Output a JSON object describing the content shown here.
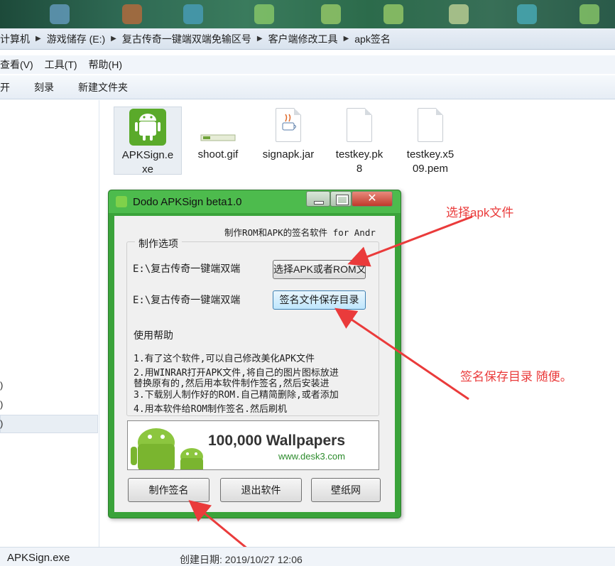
{
  "address_bar": {
    "crumbs": [
      "计算机",
      "游戏储存 (E:)",
      "复古传奇一键端双端免输区号",
      "客户端修改工具",
      "apk签名"
    ]
  },
  "menu_bar": {
    "items": [
      "查看(V)",
      "工具(T)",
      "帮助(H)"
    ]
  },
  "toolbar": {
    "items": [
      "开",
      "刻录",
      "新建文件夹"
    ]
  },
  "left_nav": {
    "items": [
      ")",
      ")",
      ")"
    ]
  },
  "files": [
    {
      "name_line1": "APKSign.e",
      "name_line2": "xe",
      "icon": "android-app-icon"
    },
    {
      "name_line1": "shoot.gif",
      "name_line2": "",
      "icon": "gif-thumbnail-icon"
    },
    {
      "name_line1": "signapk.jar",
      "name_line2": "",
      "icon": "java-jar-icon"
    },
    {
      "name_line1": "testkey.pk",
      "name_line2": "8",
      "icon": "blank-file-icon"
    },
    {
      "name_line1": "testkey.x5",
      "name_line2": "09.pem",
      "icon": "blank-file-icon"
    }
  ],
  "dialog": {
    "title": "Dodo APKSign beta1.0",
    "heading": "制作ROM和APK的签名软件 for Andr",
    "group_label": "制作选项",
    "path1": "E:\\复古传奇一键端双端",
    "path2": "E:\\复古传奇一键端双端",
    "select_button": "选择APK或者ROM文件",
    "save_dir_button": "签名文件保存目录",
    "help_title": "使用帮助",
    "help_lines": [
      "1.有了这个软件,可以自己修改美化APK文件",
      "2.用WINRAR打开APK文件,将自己的图片图标放进",
      "替换原有的,然后用本软件制作签名,然后安装进",
      "3.下载别人制作好的ROM.自己精简删除,或者添加",
      "4.用本软件给ROM制作签名.然后刷机"
    ],
    "banner_title": "100,000 Wallpapers",
    "banner_url": "www.desk3.com",
    "buttons": {
      "make_sign": "制作签名",
      "exit": "退出软件",
      "wallpaper": "壁纸网"
    }
  },
  "annotations": {
    "select_apk": "选择apk文件",
    "save_dir": "签名保存目录  随便。"
  },
  "status_bar": {
    "file_name": "APKSign.exe",
    "created": "创建日期: 2019/10/27 12:06"
  },
  "colors": {
    "dialog_frame": "#3aa33a",
    "annotation": "#ea3b3b"
  }
}
